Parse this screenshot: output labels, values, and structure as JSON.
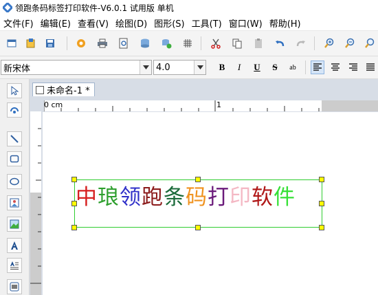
{
  "window": {
    "title": "领跑条码标签打印软件-V6.0.1 试用版 单机"
  },
  "menu": [
    "文件(F)",
    "编辑(E)",
    "查看(V)",
    "绘图(D)",
    "图形(S)",
    "工具(T)",
    "窗口(W)",
    "帮助(H)"
  ],
  "toolbar": {
    "icons": [
      "new-file-icon",
      "open-folder-icon",
      "save-icon",
      "settings-icon",
      "print-icon",
      "print-preview-icon",
      "database-icon",
      "database-settings-icon",
      "grid-icon",
      "cut-icon",
      "copy-icon",
      "paste-icon",
      "undo-icon",
      "redo-icon",
      "zoom-in-icon",
      "zoom-out-icon",
      "zoom-fit-icon"
    ]
  },
  "format": {
    "font": "新宋体",
    "size": "4.0",
    "bold": "B",
    "italic": "I",
    "underline": "U",
    "strike": "S",
    "spacing": "ab",
    "align_active": "align-left"
  },
  "tools": [
    "select-arrow-icon",
    "rotate-icon",
    "line-icon",
    "rectangle-icon",
    "ellipse-icon",
    "image-icon",
    "picture-icon",
    "text-icon",
    "text-list-icon",
    "barcode-icon"
  ],
  "document": {
    "tab": "未命名-1 *"
  },
  "ruler": {
    "zero": "0 cm",
    "one": "1"
  },
  "label": {
    "chars": [
      {
        "ch": "中",
        "color": "#d62020"
      },
      {
        "ch": "琅",
        "color": "#2e9f2e"
      },
      {
        "ch": "领",
        "color": "#2f2fc8"
      },
      {
        "ch": "跑",
        "color": "#8b1a1a"
      },
      {
        "ch": "条",
        "color": "#1b6b3a"
      },
      {
        "ch": "码",
        "color": "#f0921e"
      },
      {
        "ch": "打",
        "color": "#6a1a7a"
      },
      {
        "ch": "印",
        "color": "#f4b8c4"
      },
      {
        "ch": "软",
        "color": "#b01818"
      },
      {
        "ch": "件",
        "color": "#36e036"
      }
    ],
    "selection_color": "#2ecc2e",
    "handle_color": "#ffff00"
  }
}
